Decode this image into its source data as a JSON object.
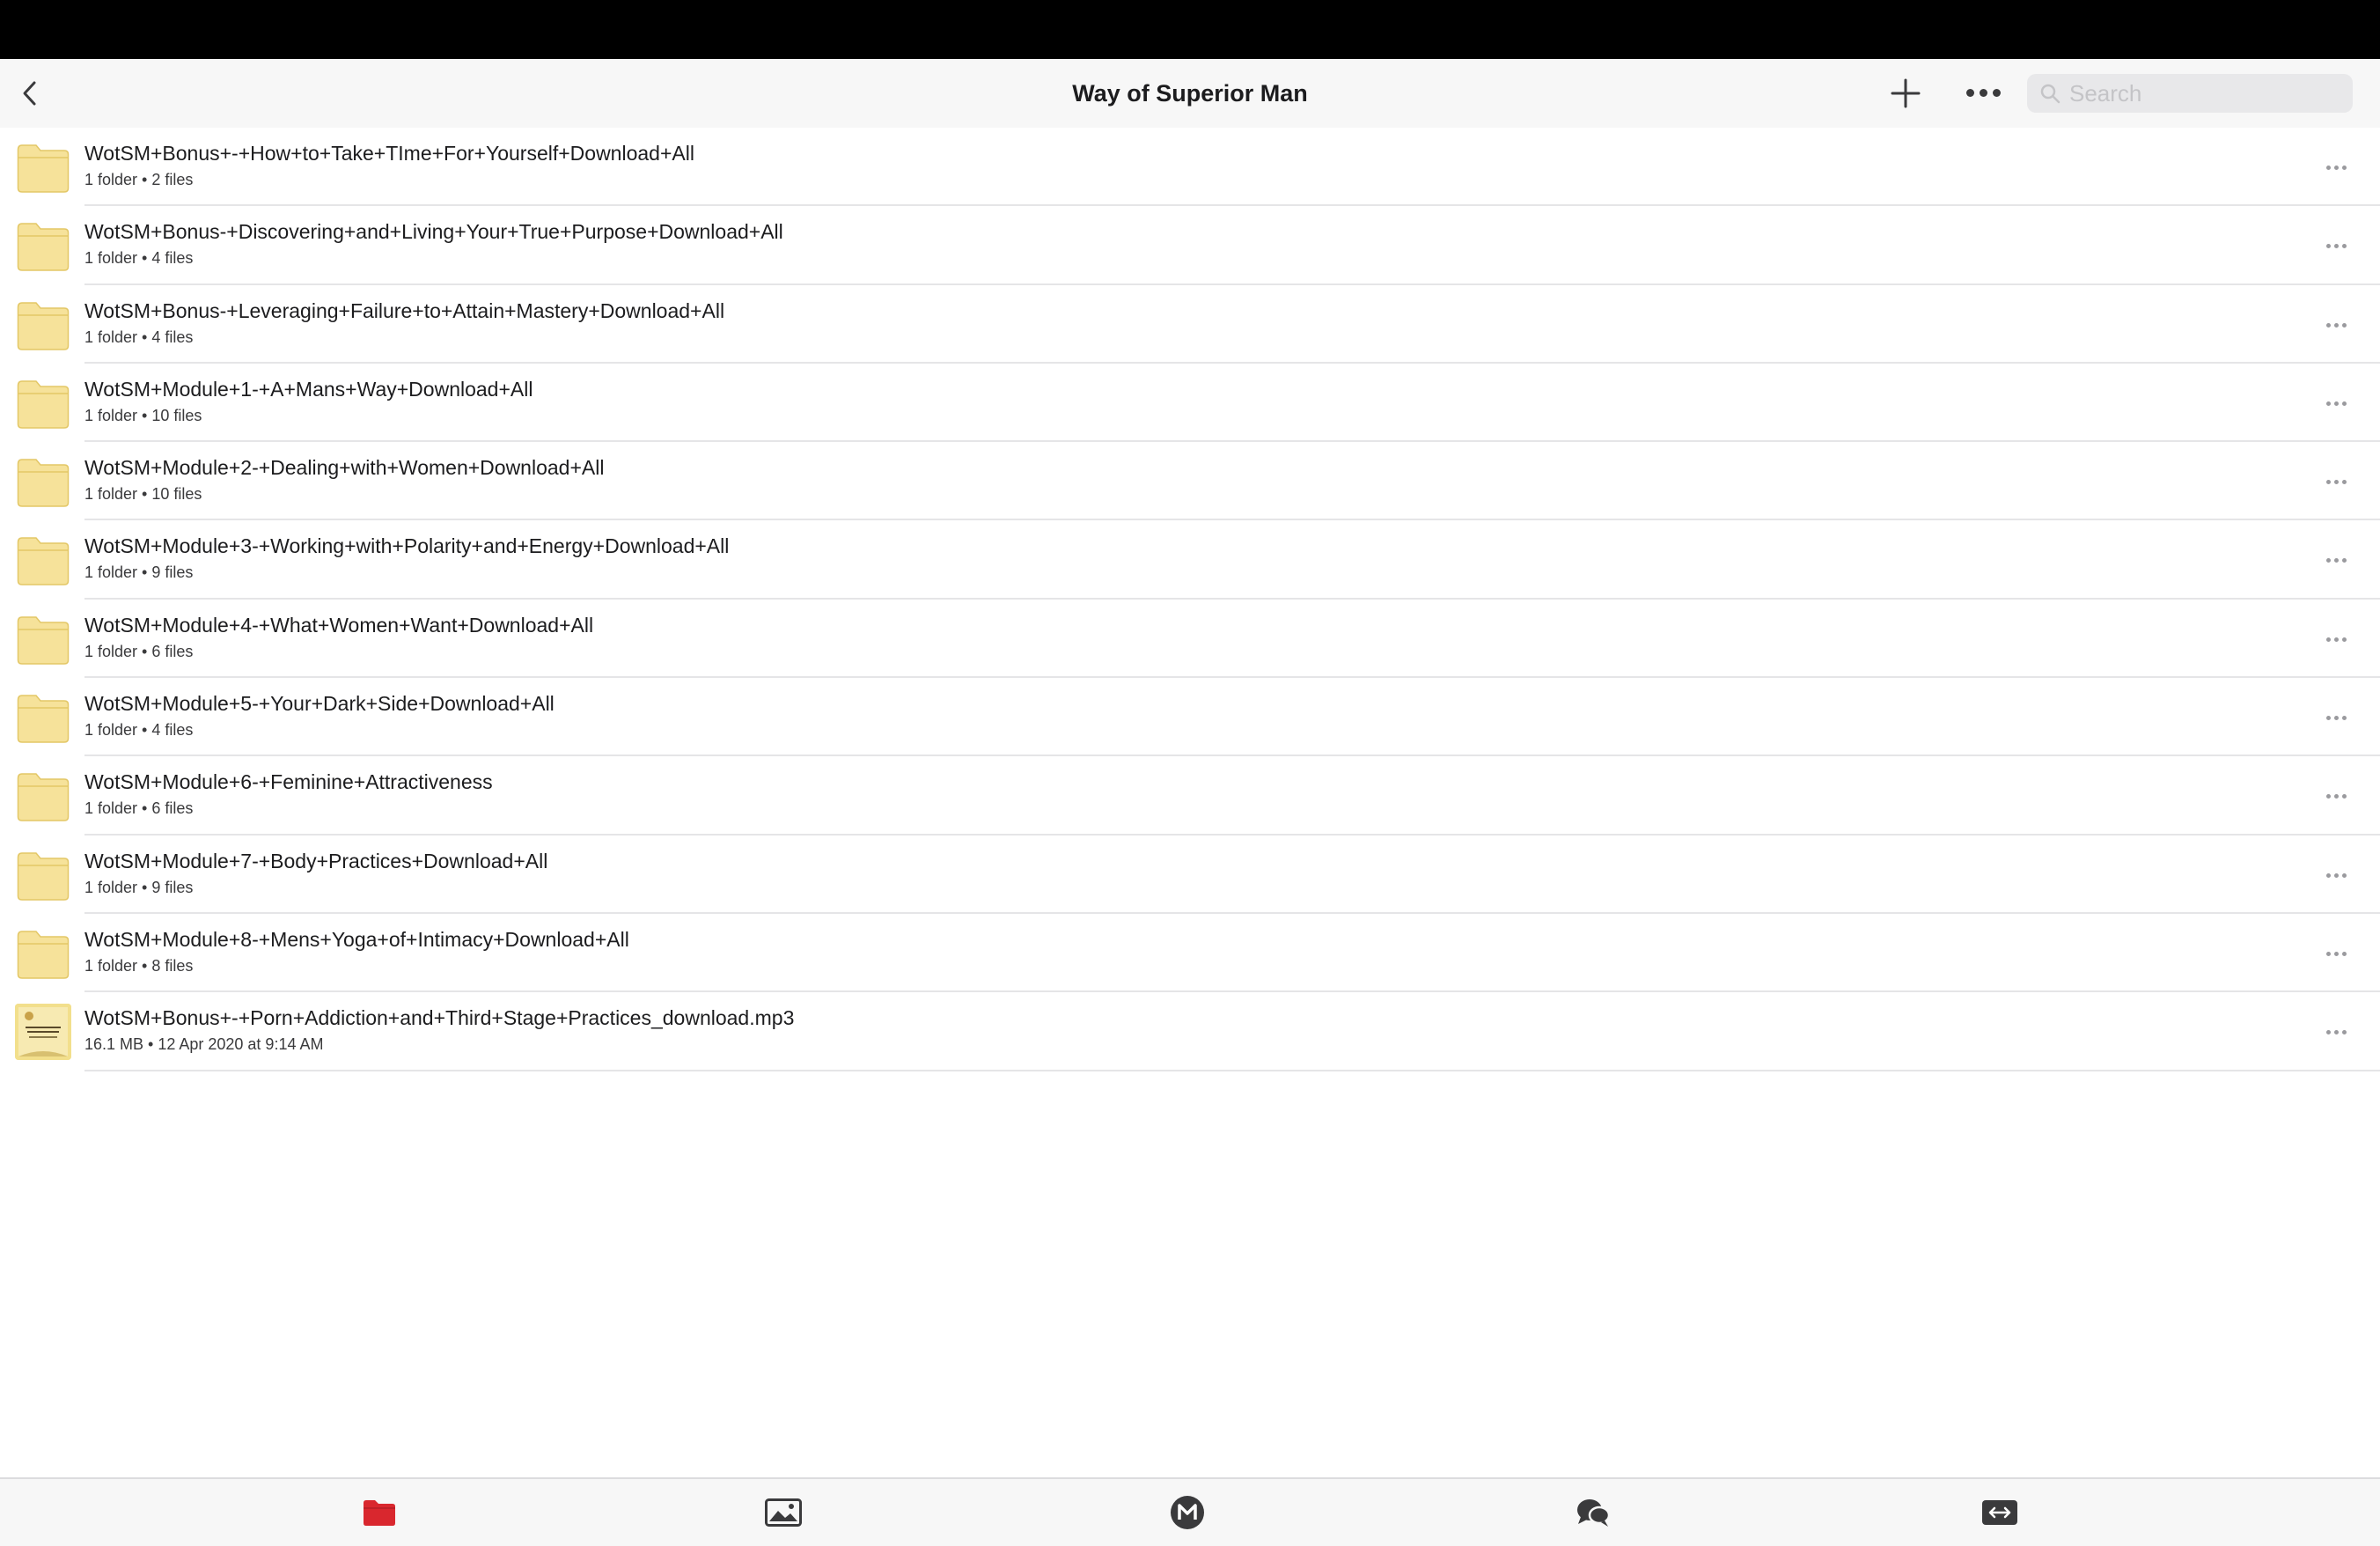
{
  "nav": {
    "title": "Way of Superior Man",
    "search_placeholder": "Search"
  },
  "items": [
    {
      "kind": "folder",
      "name": "WotSM+Bonus+-+How+to+Take+TIme+For+Yourself+Download+All",
      "meta": "1 folder • 2 files"
    },
    {
      "kind": "folder",
      "name": "WotSM+Bonus-+Discovering+and+Living+Your+True+Purpose+Download+All",
      "meta": "1 folder • 4 files"
    },
    {
      "kind": "folder",
      "name": "WotSM+Bonus-+Leveraging+Failure+to+Attain+Mastery+Download+All",
      "meta": "1 folder • 4 files"
    },
    {
      "kind": "folder",
      "name": "WotSM+Module+1-+A+Mans+Way+Download+All",
      "meta": "1 folder • 10 files"
    },
    {
      "kind": "folder",
      "name": "WotSM+Module+2-+Dealing+with+Women+Download+All",
      "meta": "1 folder • 10 files"
    },
    {
      "kind": "folder",
      "name": "WotSM+Module+3-+Working+with+Polarity+and+Energy+Download+All",
      "meta": "1 folder • 9 files"
    },
    {
      "kind": "folder",
      "name": "WotSM+Module+4-+What+Women+Want+Download+All",
      "meta": "1 folder • 6 files"
    },
    {
      "kind": "folder",
      "name": "WotSM+Module+5-+Your+Dark+Side+Download+All",
      "meta": "1 folder • 4 files"
    },
    {
      "kind": "folder",
      "name": "WotSM+Module+6-+Feminine+Attractiveness",
      "meta": "1 folder • 6 files"
    },
    {
      "kind": "folder",
      "name": "WotSM+Module+7-+Body+Practices+Download+All",
      "meta": "1 folder • 9 files"
    },
    {
      "kind": "folder",
      "name": "WotSM+Module+8-+Mens+Yoga+of+Intimacy+Download+All",
      "meta": "1 folder • 8 files"
    },
    {
      "kind": "file",
      "name": "WotSM+Bonus+-+Porn+Addiction+and+Third+Stage+Practices_download.mp3",
      "meta": "16.1 MB • 12 Apr 2020 at 9:14 AM"
    }
  ],
  "tabs": [
    {
      "id": "cloud-drive",
      "icon": "folder-icon",
      "active": true
    },
    {
      "id": "photos",
      "icon": "photo-icon",
      "active": false
    },
    {
      "id": "home",
      "icon": "mega-logo-icon",
      "active": false
    },
    {
      "id": "chat",
      "icon": "chat-bubbles-icon",
      "active": false
    },
    {
      "id": "transfers",
      "icon": "transfers-icon",
      "active": false
    }
  ],
  "colors": {
    "accent": "#d9272e",
    "folder_fill": "#f6e29a",
    "folder_stroke": "#e3c766",
    "tab_icon": "#3a3a3c"
  }
}
